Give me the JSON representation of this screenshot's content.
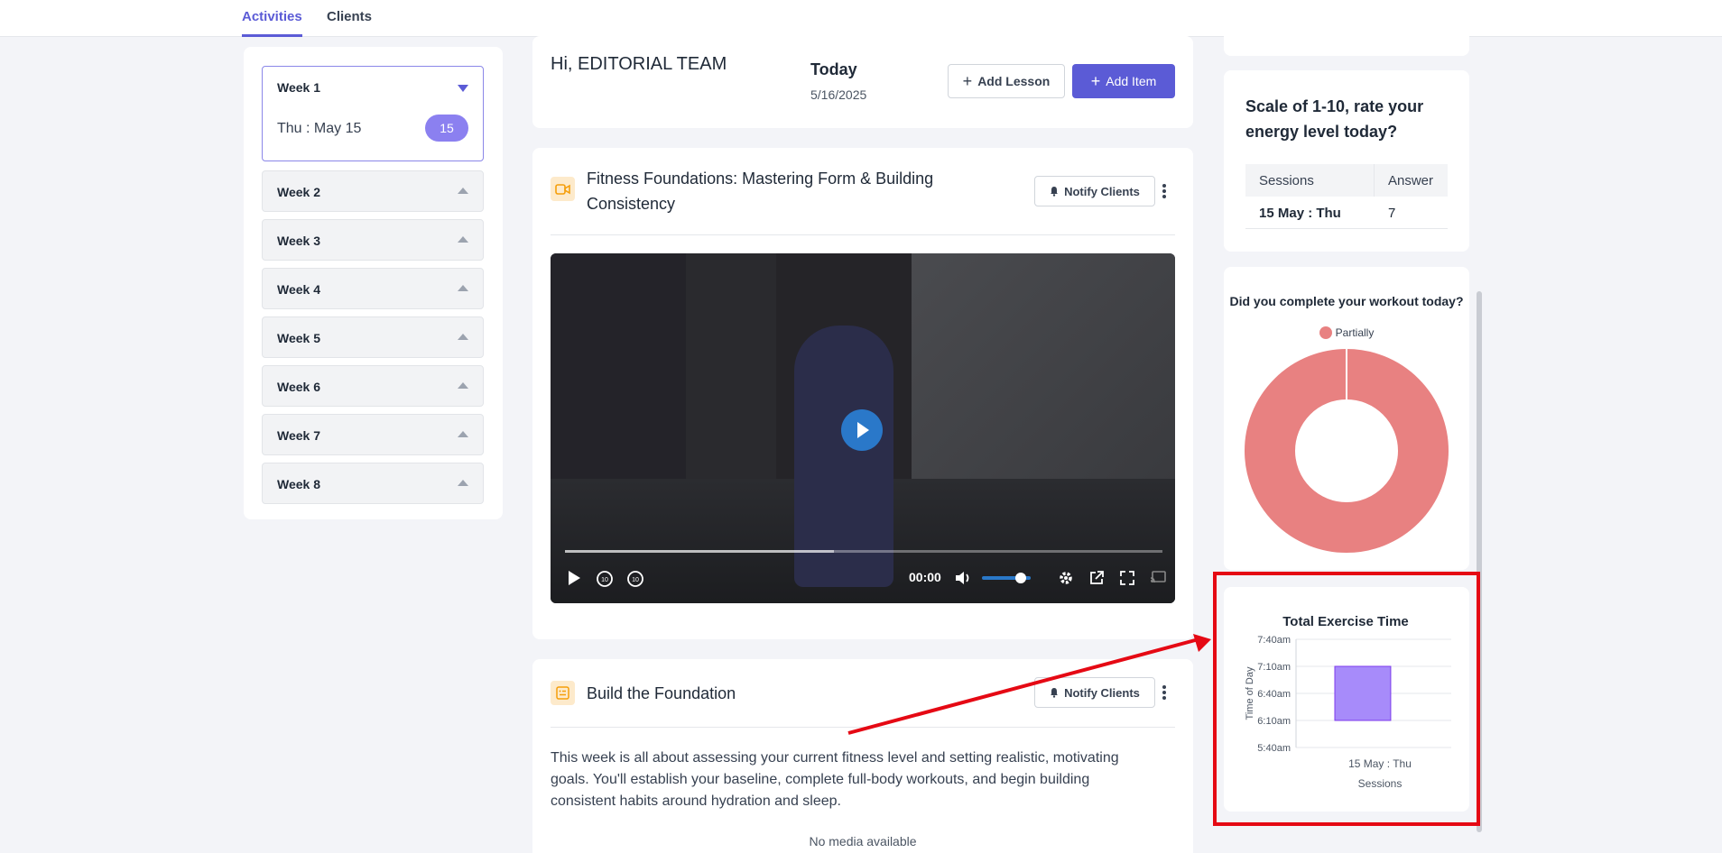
{
  "nav": {
    "tabs": [
      "Activities",
      "Clients"
    ]
  },
  "sidebar": {
    "weeks": [
      {
        "label": "Week 1",
        "session_date": "Thu : May 15",
        "session_count": "15"
      },
      {
        "label": "Week 2"
      },
      {
        "label": "Week 3"
      },
      {
        "label": "Week 4"
      },
      {
        "label": "Week 5"
      },
      {
        "label": "Week 6"
      },
      {
        "label": "Week 7"
      },
      {
        "label": "Week 8"
      }
    ]
  },
  "header": {
    "greeting": "Hi, EDITORIAL TEAM",
    "today_label": "Today",
    "today_date": "5/16/2025",
    "add_lesson": "Add Lesson",
    "add_item": "Add Item"
  },
  "lesson1": {
    "title": "Fitness Foundations: Mastering Form & Building Consistency",
    "notify": "Notify Clients",
    "video": {
      "time": "00:00",
      "progress": 0.45,
      "volume": 0.8
    }
  },
  "lesson2": {
    "title": "Build the Foundation",
    "notify": "Notify Clients",
    "description": "This week is all about assessing your current fitness level and setting realistic, motivating goals. You'll establish your baseline, complete full-body workouts, and begin building consistent habits around hydration and sleep.",
    "no_media": "No media available"
  },
  "energy": {
    "question": "Scale of 1-10, rate your energy level today?",
    "headers": [
      "Sessions",
      "Answer"
    ],
    "rows": [
      {
        "session": "15 May : Thu",
        "answer": "7"
      }
    ]
  },
  "workout": {
    "question": "Did you complete your workout today?",
    "legend": "Partially"
  },
  "chart_data": {
    "type": "bar",
    "title": "Total Exercise Time",
    "xlabel": "Sessions",
    "ylabel": "Time of Day",
    "categories": [
      "15 May : Thu"
    ],
    "y_ticks": [
      "5:40am",
      "6:10am",
      "6:40am",
      "7:10am",
      "7:40am"
    ],
    "ylim_minutes": [
      340,
      460
    ],
    "bars": [
      {
        "start_minutes": 370,
        "end_minutes": 430
      }
    ],
    "color": "#a78bfa"
  },
  "pie_data": {
    "type": "pie",
    "slices": [
      {
        "label": "Partially",
        "value": 1,
        "color": "#e88181"
      }
    ]
  },
  "colors": {
    "accent": "#5b5bd6",
    "badge": "#8b80f0",
    "highlight": "#e50914"
  }
}
